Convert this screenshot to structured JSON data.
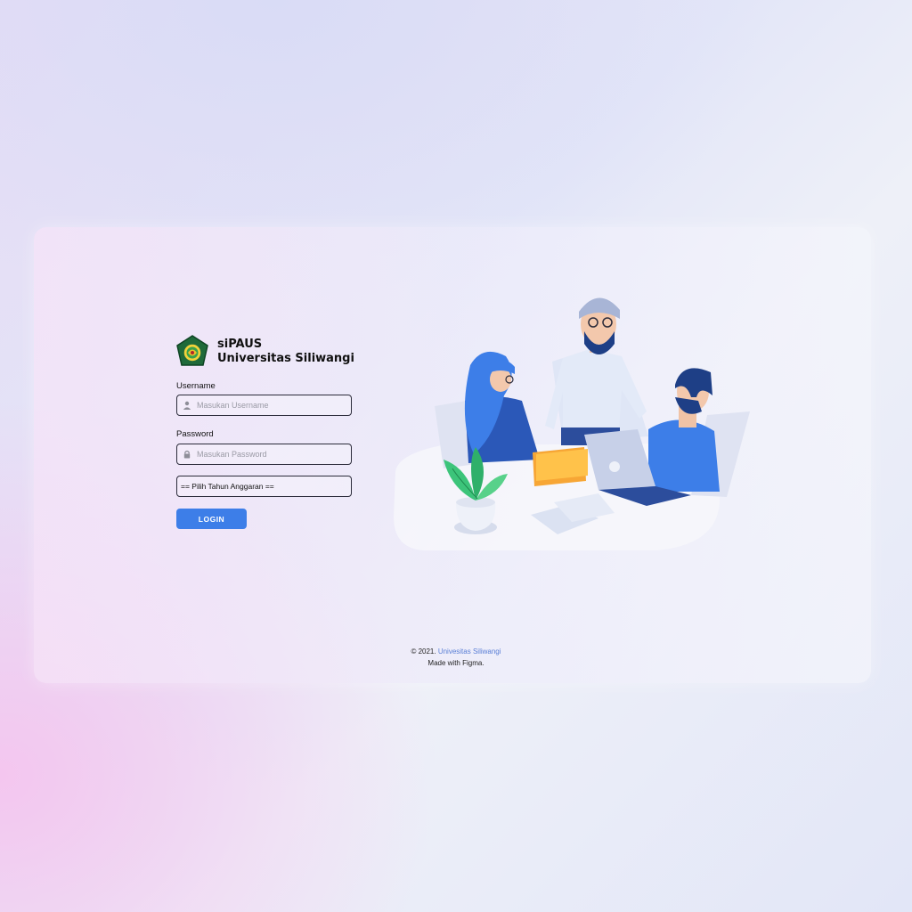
{
  "brand": {
    "line1": "siPAUS",
    "line2": "Universitas Siliwangi"
  },
  "form": {
    "username_label": "Username",
    "username_placeholder": "Masukan Username",
    "password_label": "Password",
    "password_placeholder": "Masukan Password",
    "year_select_value": "== Pilih Tahun Anggaran ==",
    "login_button": "LOGIN"
  },
  "footer": {
    "copyright": "© 2021.",
    "link_text": "Univesitas Siliwangi",
    "made_with": "Made with Figma."
  },
  "colors": {
    "accent": "#3d7ee8",
    "field_border": "#2b2b3a"
  },
  "icons": [
    "user-icon",
    "lock-icon",
    "university-logo"
  ]
}
